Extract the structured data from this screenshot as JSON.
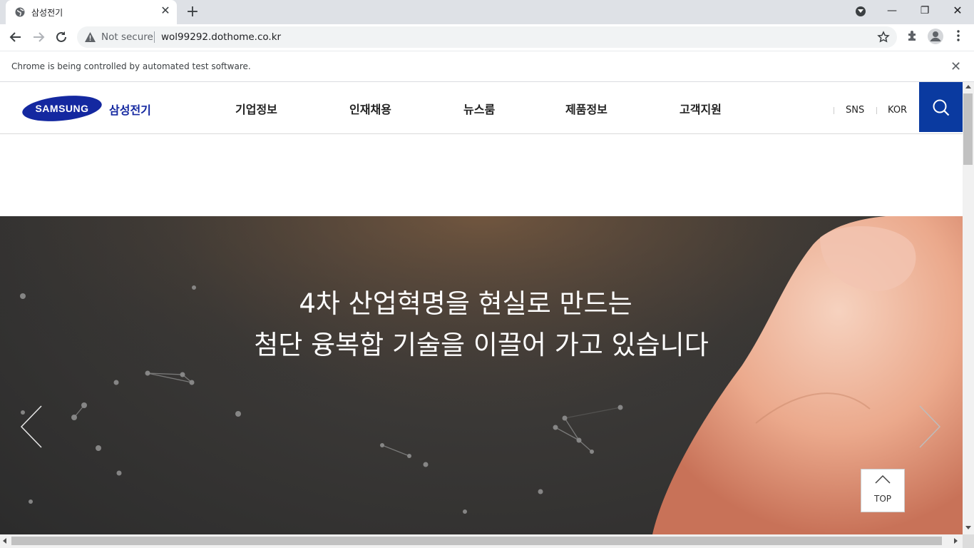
{
  "browser": {
    "tab_title": "삼성전기",
    "tab_close": "✕",
    "new_tab": "+",
    "security_label": "Not secure",
    "url": "wol99292.dothome.co.kr",
    "infobar_message": "Chrome is being controlled by automated test software.",
    "infobar_close": "✕",
    "window_controls": {
      "minimize": "—",
      "restore": "❐",
      "close": "✕"
    }
  },
  "site": {
    "logo_text": "SAMSUNG",
    "brand_kr": "삼성전기",
    "nav": [
      "기업정보",
      "인재채용",
      "뉴스룸",
      "제품정보",
      "고객지원"
    ],
    "util": [
      "SNS",
      "KOR"
    ],
    "colors": {
      "brand_blue": "#1428a0",
      "search_bg": "#0a3aa0"
    }
  },
  "hero": {
    "line1": "4차 산업혁명을 현실로 만드는",
    "line2": "첨단 융복합 기술을 이끌어 가고 있습니다"
  },
  "top_button": {
    "label": "TOP"
  },
  "icons": [
    "globe-icon",
    "warning-icon",
    "star-icon",
    "extensions-icon",
    "account-icon",
    "menu-icon",
    "search-icon",
    "chevron-left-icon",
    "chevron-right-icon",
    "chevron-up-icon"
  ]
}
